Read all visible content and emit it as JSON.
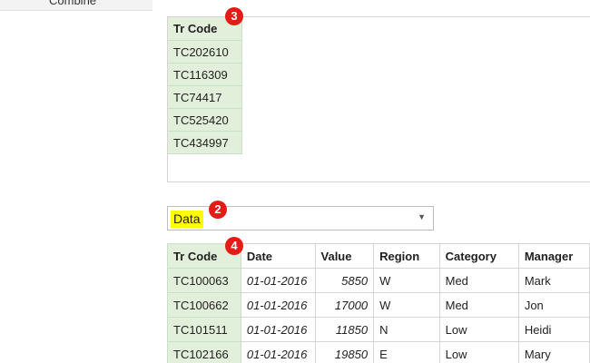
{
  "left_pane": {
    "combine_label": "Combine"
  },
  "top_panel": {
    "header": "Tr Code",
    "codes": [
      "TC202610",
      "TC116309",
      "TC74417",
      "TC525420",
      "TC434997"
    ]
  },
  "badges": {
    "b3": "3",
    "b2": "2",
    "b4": "4"
  },
  "dropdown": {
    "selected": "Data"
  },
  "data_table": {
    "columns": [
      "Tr Code",
      "Date",
      "Value",
      "Region",
      "Category",
      "Manager"
    ],
    "rows": [
      [
        "TC100063",
        "01-01-2016",
        "5850",
        "W",
        "Med",
        "Mark"
      ],
      [
        "TC100662",
        "01-01-2016",
        "17000",
        "W",
        "Med",
        "Jon"
      ],
      [
        "TC101511",
        "01-01-2016",
        "11850",
        "N",
        "Low",
        "Heidi"
      ],
      [
        "TC102166",
        "01-01-2016",
        "19850",
        "E",
        "Low",
        "Mary"
      ]
    ]
  },
  "colors": {
    "highlight_green": "#e2efda",
    "badge_red": "#e51b16",
    "highlight_yellow": "#ffff00"
  }
}
